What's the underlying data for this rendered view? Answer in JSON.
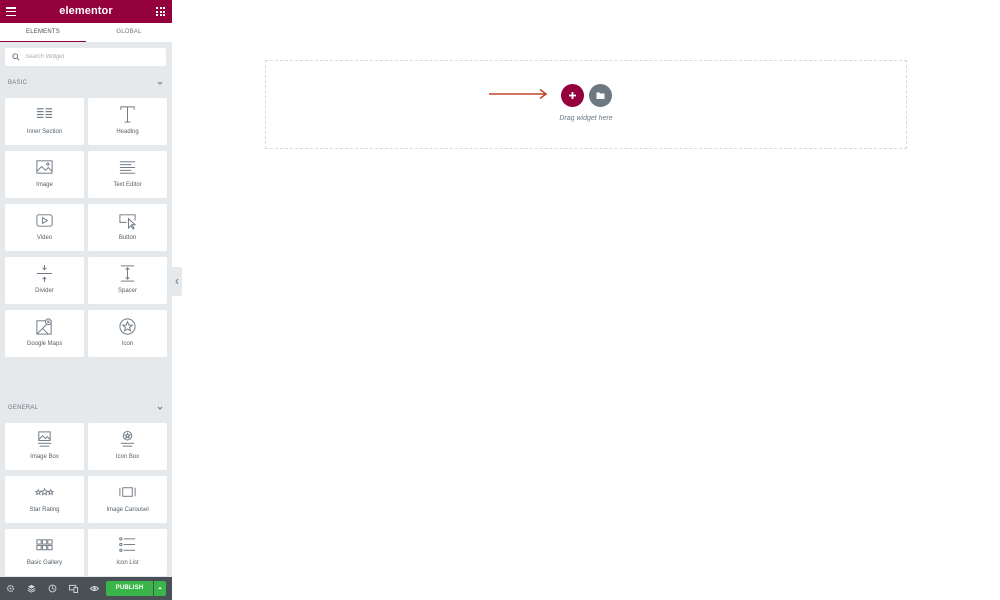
{
  "app": {
    "logo": "elementor",
    "accent": "#93003c",
    "publish_color": "#39b54a"
  },
  "tabs": [
    {
      "label": "ELEMENTS",
      "active": true
    },
    {
      "label": "GLOBAL",
      "active": false
    }
  ],
  "search": {
    "placeholder": "Search Widget"
  },
  "categories": {
    "basic": {
      "title": "BASIC",
      "widgets": [
        {
          "label": "Inner Section",
          "icon": "inner-section-icon"
        },
        {
          "label": "Heading",
          "icon": "heading-icon"
        },
        {
          "label": "Image",
          "icon": "image-icon"
        },
        {
          "label": "Text Editor",
          "icon": "text-editor-icon"
        },
        {
          "label": "Video",
          "icon": "video-icon"
        },
        {
          "label": "Button",
          "icon": "button-icon"
        },
        {
          "label": "Divider",
          "icon": "divider-icon"
        },
        {
          "label": "Spacer",
          "icon": "spacer-icon"
        },
        {
          "label": "Google Maps",
          "icon": "google-maps-icon"
        },
        {
          "label": "Icon",
          "icon": "star-icon"
        }
      ]
    },
    "general": {
      "title": "GENERAL",
      "widgets": [
        {
          "label": "Image Box",
          "icon": "image-box-icon"
        },
        {
          "label": "Icon Box",
          "icon": "icon-box-icon"
        },
        {
          "label": "Star Rating",
          "icon": "star-rating-icon"
        },
        {
          "label": "Image Carousel",
          "icon": "image-carousel-icon"
        },
        {
          "label": "Basic Gallery",
          "icon": "gallery-icon"
        },
        {
          "label": "Icon List",
          "icon": "icon-list-icon"
        }
      ]
    }
  },
  "footer": {
    "icons": [
      "settings-icon",
      "layers-icon",
      "history-icon",
      "responsive-icon",
      "preview-icon"
    ],
    "publish_label": "PUBLISH"
  },
  "canvas": {
    "drop_text": "Drag widget here"
  }
}
